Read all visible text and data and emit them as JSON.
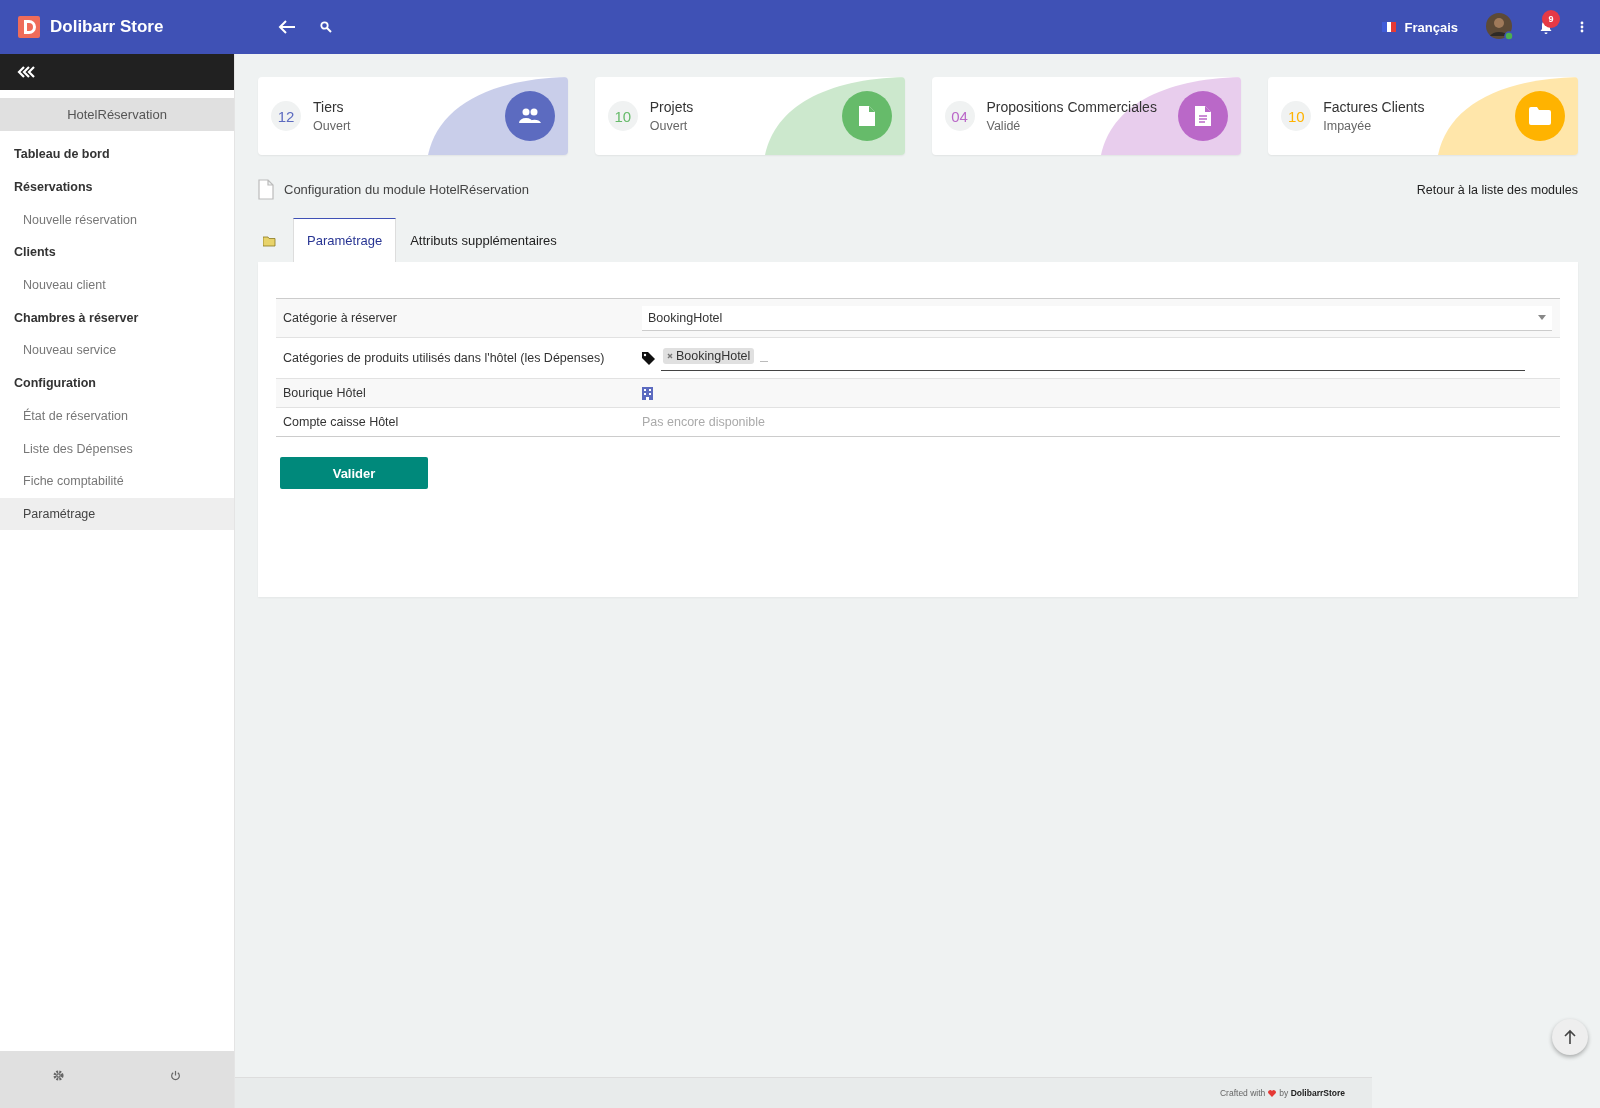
{
  "header": {
    "brand": "Dolibarr Store",
    "language": "Français",
    "notification_count": "9"
  },
  "sidebar": {
    "module_title": "HotelRéservation",
    "items": [
      {
        "label": "Tableau de bord",
        "kind": "heading",
        "selected": false
      },
      {
        "label": "Réservations",
        "kind": "heading",
        "selected": false
      },
      {
        "label": "Nouvelle réservation",
        "kind": "sub",
        "selected": false
      },
      {
        "label": "Clients",
        "kind": "heading",
        "selected": false
      },
      {
        "label": "Nouveau client",
        "kind": "sub",
        "selected": false
      },
      {
        "label": "Chambres à réserver",
        "kind": "heading",
        "selected": false
      },
      {
        "label": "Nouveau service",
        "kind": "sub",
        "selected": false
      },
      {
        "label": "Configuration",
        "kind": "heading",
        "selected": false
      },
      {
        "label": "État de réservation",
        "kind": "sub",
        "selected": false
      },
      {
        "label": "Liste des Dépenses",
        "kind": "sub",
        "selected": false
      },
      {
        "label": "Fiche comptabilité",
        "kind": "sub",
        "selected": false
      },
      {
        "label": "Paramétrage",
        "kind": "sub",
        "selected": true
      }
    ]
  },
  "cards": [
    {
      "count": "12",
      "title": "Tiers",
      "status": "Ouvert",
      "color": "#5c6bc0",
      "kind": "people"
    },
    {
      "count": "10",
      "title": "Projets",
      "status": "Ouvert",
      "color": "#66bb6a",
      "kind": "file"
    },
    {
      "count": "04",
      "title": "Propositions Commerciales",
      "status": "Validé",
      "color": "#ba68c8",
      "kind": "document"
    },
    {
      "count": "10",
      "title": "Factures Clients",
      "status": "Impayée",
      "color": "#ffb300",
      "kind": "folder"
    }
  ],
  "page": {
    "title": "Configuration du module HotelRéservation",
    "back_link": "Retour à la liste des modules"
  },
  "tabs": [
    {
      "label": "Paramétrage",
      "selected": true
    },
    {
      "label": "Attributs supplémentaires",
      "selected": false
    }
  ],
  "settings": [
    {
      "label": "Catégorie à réserver",
      "kind": "select",
      "value": "BookingHotel"
    },
    {
      "label": "Catégories de produits utilisés dans l'hôtel (les Dépenses)",
      "kind": "tags",
      "tags": [
        "BookingHotel"
      ]
    },
    {
      "label": "Bourique Hôtel",
      "kind": "icon"
    },
    {
      "label": "Compte caisse Hôtel",
      "kind": "note",
      "value": "Pas encore disponible"
    }
  ],
  "submit": "Valider",
  "footer": {
    "prefix": "Crafted with",
    "suffix": "by **DolibarrStore**"
  }
}
